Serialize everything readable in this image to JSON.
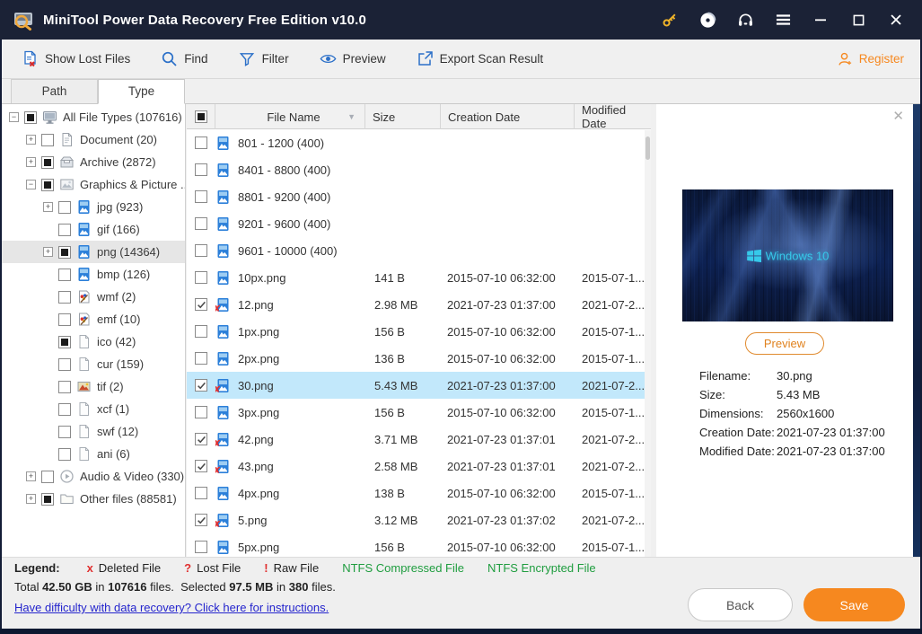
{
  "window": {
    "title": "MiniTool Power Data Recovery Free Edition v10.0"
  },
  "toolbar": {
    "items": [
      {
        "label": "Show Lost Files",
        "icon": "show-lost-files-icon"
      },
      {
        "label": "Find",
        "icon": "find-icon"
      },
      {
        "label": "Filter",
        "icon": "filter-icon"
      },
      {
        "label": "Preview",
        "icon": "preview-icon"
      },
      {
        "label": "Export Scan Result",
        "icon": "export-icon"
      }
    ],
    "register_label": "Register"
  },
  "tabs": [
    {
      "label": "Path",
      "active": false
    },
    {
      "label": "Type",
      "active": true
    }
  ],
  "tree": {
    "items": [
      {
        "label": "All File Types (107616)",
        "level": 0,
        "expander": "minus",
        "check": "partial",
        "icon": "monitor",
        "selected": false
      },
      {
        "label": "Document (20)",
        "level": 1,
        "expander": "plus",
        "check": "none",
        "icon": "document",
        "selected": false
      },
      {
        "label": "Archive (2872)",
        "level": 1,
        "expander": "plus",
        "check": "partial",
        "icon": "archive",
        "selected": false
      },
      {
        "label": "Graphics & Picture ...",
        "level": 1,
        "expander": "minus",
        "check": "partial",
        "icon": "picture",
        "selected": false
      },
      {
        "label": "jpg (923)",
        "level": 2,
        "expander": "plus",
        "check": "none",
        "icon": "image-file",
        "selected": false
      },
      {
        "label": "gif (166)",
        "level": 2,
        "expander": "none",
        "check": "none",
        "icon": "image-file",
        "selected": false
      },
      {
        "label": "png (14364)",
        "level": 2,
        "expander": "plus",
        "check": "partial",
        "icon": "image-file",
        "selected": true
      },
      {
        "label": "bmp (126)",
        "level": 2,
        "expander": "none",
        "check": "none",
        "icon": "image-file",
        "selected": false
      },
      {
        "label": "wmf (2)",
        "level": 2,
        "expander": "none",
        "check": "none",
        "icon": "paint-file",
        "selected": false
      },
      {
        "label": "emf (10)",
        "level": 2,
        "expander": "none",
        "check": "none",
        "icon": "paint-file",
        "selected": false
      },
      {
        "label": "ico (42)",
        "level": 2,
        "expander": "none",
        "check": "partial",
        "icon": "plain-file",
        "selected": false
      },
      {
        "label": "cur (159)",
        "level": 2,
        "expander": "none",
        "check": "none",
        "icon": "plain-file",
        "selected": false
      },
      {
        "label": "tif (2)",
        "level": 2,
        "expander": "none",
        "check": "none",
        "icon": "tif-file",
        "selected": false
      },
      {
        "label": "xcf (1)",
        "level": 2,
        "expander": "none",
        "check": "none",
        "icon": "plain-file",
        "selected": false
      },
      {
        "label": "swf (12)",
        "level": 2,
        "expander": "none",
        "check": "none",
        "icon": "plain-file",
        "selected": false
      },
      {
        "label": "ani (6)",
        "level": 2,
        "expander": "none",
        "check": "none",
        "icon": "plain-file",
        "selected": false
      },
      {
        "label": "Audio & Video (330)",
        "level": 1,
        "expander": "plus",
        "check": "none",
        "icon": "media",
        "selected": false
      },
      {
        "label": "Other files (88581)",
        "level": 1,
        "expander": "plus",
        "check": "partial",
        "icon": "folder",
        "selected": false
      }
    ]
  },
  "table": {
    "columns": [
      "File Name",
      "Size",
      "Creation Date",
      "Modified Date"
    ],
    "rows": [
      {
        "name": "801 - 1200 (400)",
        "size": "",
        "created": "",
        "modified": "",
        "check": "none",
        "icon": "image-file",
        "selected": false
      },
      {
        "name": "8401 - 8800 (400)",
        "size": "",
        "created": "",
        "modified": "",
        "check": "none",
        "icon": "image-file",
        "selected": false
      },
      {
        "name": "8801 - 9200 (400)",
        "size": "",
        "created": "",
        "modified": "",
        "check": "none",
        "icon": "image-file",
        "selected": false
      },
      {
        "name": "9201 - 9600 (400)",
        "size": "",
        "created": "",
        "modified": "",
        "check": "none",
        "icon": "image-file",
        "selected": false
      },
      {
        "name": "9601 - 10000 (400)",
        "size": "",
        "created": "",
        "modified": "",
        "check": "none",
        "icon": "image-file",
        "selected": false
      },
      {
        "name": "10px.png",
        "size": "141 B",
        "created": "2015-07-10 06:32:00",
        "modified": "2015-07-1...",
        "check": "none",
        "icon": "image-file",
        "selected": false
      },
      {
        "name": "12.png",
        "size": "2.98 MB",
        "created": "2021-07-23 01:37:00",
        "modified": "2021-07-2...",
        "check": "checked",
        "icon": "deleted-image-file",
        "selected": false
      },
      {
        "name": "1px.png",
        "size": "156 B",
        "created": "2015-07-10 06:32:00",
        "modified": "2015-07-1...",
        "check": "none",
        "icon": "image-file",
        "selected": false
      },
      {
        "name": "2px.png",
        "size": "136 B",
        "created": "2015-07-10 06:32:00",
        "modified": "2015-07-1...",
        "check": "none",
        "icon": "image-file",
        "selected": false
      },
      {
        "name": "30.png",
        "size": "5.43 MB",
        "created": "2021-07-23 01:37:00",
        "modified": "2021-07-2...",
        "check": "checked",
        "icon": "deleted-image-file",
        "selected": true
      },
      {
        "name": "3px.png",
        "size": "156 B",
        "created": "2015-07-10 06:32:00",
        "modified": "2015-07-1...",
        "check": "none",
        "icon": "image-file",
        "selected": false
      },
      {
        "name": "42.png",
        "size": "3.71 MB",
        "created": "2021-07-23 01:37:01",
        "modified": "2021-07-2...",
        "check": "checked",
        "icon": "deleted-image-file",
        "selected": false
      },
      {
        "name": "43.png",
        "size": "2.58 MB",
        "created": "2021-07-23 01:37:01",
        "modified": "2021-07-2...",
        "check": "checked",
        "icon": "deleted-image-file",
        "selected": false
      },
      {
        "name": "4px.png",
        "size": "138 B",
        "created": "2015-07-10 06:32:00",
        "modified": "2015-07-1...",
        "check": "none",
        "icon": "image-file",
        "selected": false
      },
      {
        "name": "5.png",
        "size": "3.12 MB",
        "created": "2021-07-23 01:37:02",
        "modified": "2021-07-2...",
        "check": "checked",
        "icon": "deleted-image-file",
        "selected": false
      },
      {
        "name": "5px.png",
        "size": "156 B",
        "created": "2015-07-10 06:32:00",
        "modified": "2015-07-1...",
        "check": "none",
        "icon": "image-file",
        "selected": false
      }
    ]
  },
  "preview": {
    "wallpaper_text": "Windows 10",
    "button_label": "Preview",
    "details": [
      {
        "label": "Filename:",
        "value": "30.png"
      },
      {
        "label": "Size:",
        "value": "5.43 MB"
      },
      {
        "label": "Dimensions:",
        "value": "2560x1600"
      },
      {
        "label": "Creation Date:",
        "value": "2021-07-23 01:37:00"
      },
      {
        "label": "Modified Date:",
        "value": "2021-07-23 01:37:00"
      }
    ]
  },
  "legend": {
    "title": "Legend:",
    "items": [
      {
        "mark": "x",
        "label": "Deleted File",
        "mark_color": "#e02f2f",
        "label_color": "#222222"
      },
      {
        "mark": "?",
        "label": "Lost File",
        "mark_color": "#e02f2f",
        "label_color": "#222222"
      },
      {
        "mark": "!",
        "label": "Raw File",
        "mark_color": "#e02f2f",
        "label_color": "#222222"
      },
      {
        "mark": "",
        "label": "NTFS Compressed File",
        "mark_color": "",
        "label_color": "#1f9d3f"
      },
      {
        "mark": "",
        "label": "NTFS Encrypted File",
        "mark_color": "",
        "label_color": "#1f9d3f"
      }
    ]
  },
  "status": {
    "segments": [
      {
        "text": "Total ",
        "bold": false
      },
      {
        "text": "42.50 GB",
        "bold": true
      },
      {
        "text": " in ",
        "bold": false
      },
      {
        "text": "107616",
        "bold": true
      },
      {
        "text": " files.  Selected ",
        "bold": false
      },
      {
        "text": "97.5 MB",
        "bold": true
      },
      {
        "text": " in ",
        "bold": false
      },
      {
        "text": "380",
        "bold": true
      },
      {
        "text": " files.",
        "bold": false
      }
    ]
  },
  "footer": {
    "link": "Have difficulty with data recovery? Click here for instructions.",
    "back_label": "Back",
    "save_label": "Save"
  },
  "colors": {
    "titlebar": "#1b2236",
    "accent_orange": "#f6881f",
    "toolbar_icon_blue": "#2a6fc8",
    "selection_blue": "#c2e8fb",
    "ntfs_green": "#1f9d3f",
    "deleted_red": "#e02f2f",
    "link_blue": "#2424cd"
  }
}
